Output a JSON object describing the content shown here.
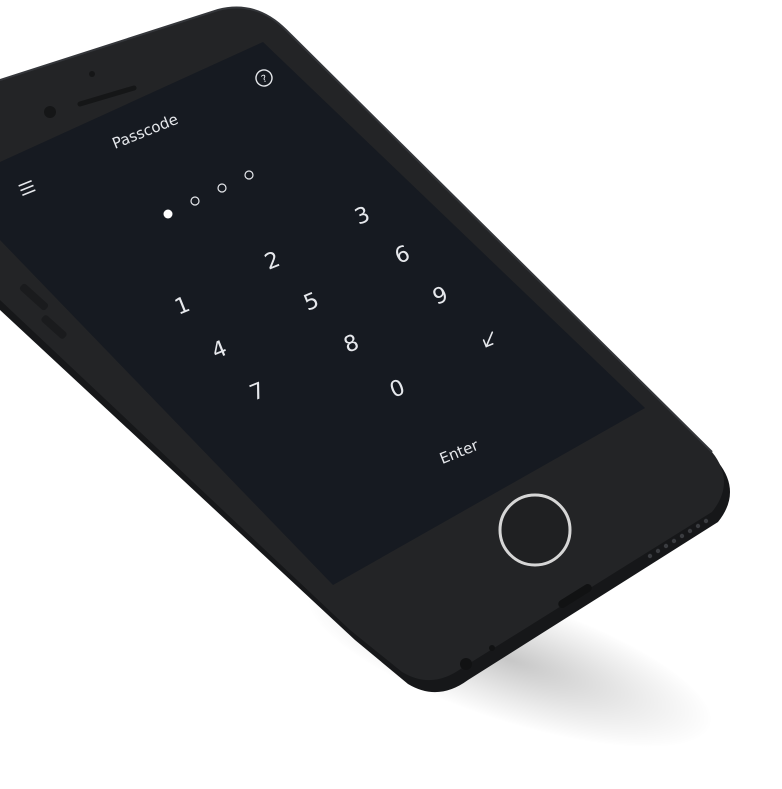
{
  "screen": {
    "title": "Passcode",
    "help_icon": "question-circle-icon",
    "menu_icon": "hamburger-menu-icon",
    "passcode": {
      "length": 4,
      "filled": 1
    },
    "keypad": {
      "keys": [
        "1",
        "2",
        "3",
        "4",
        "5",
        "6",
        "7",
        "8",
        "9",
        "0"
      ],
      "backspace_icon": "backspace-arrow-icon"
    },
    "enter_label": "Enter"
  },
  "device": {
    "home_button_icon": "home-button-ring-icon"
  },
  "colors": {
    "body": "#1f2022",
    "body_edge": "#2a2b2e",
    "screen_bg": "#161a21",
    "text": "#e6e8ec",
    "home_ring": "#d6d6d6"
  }
}
